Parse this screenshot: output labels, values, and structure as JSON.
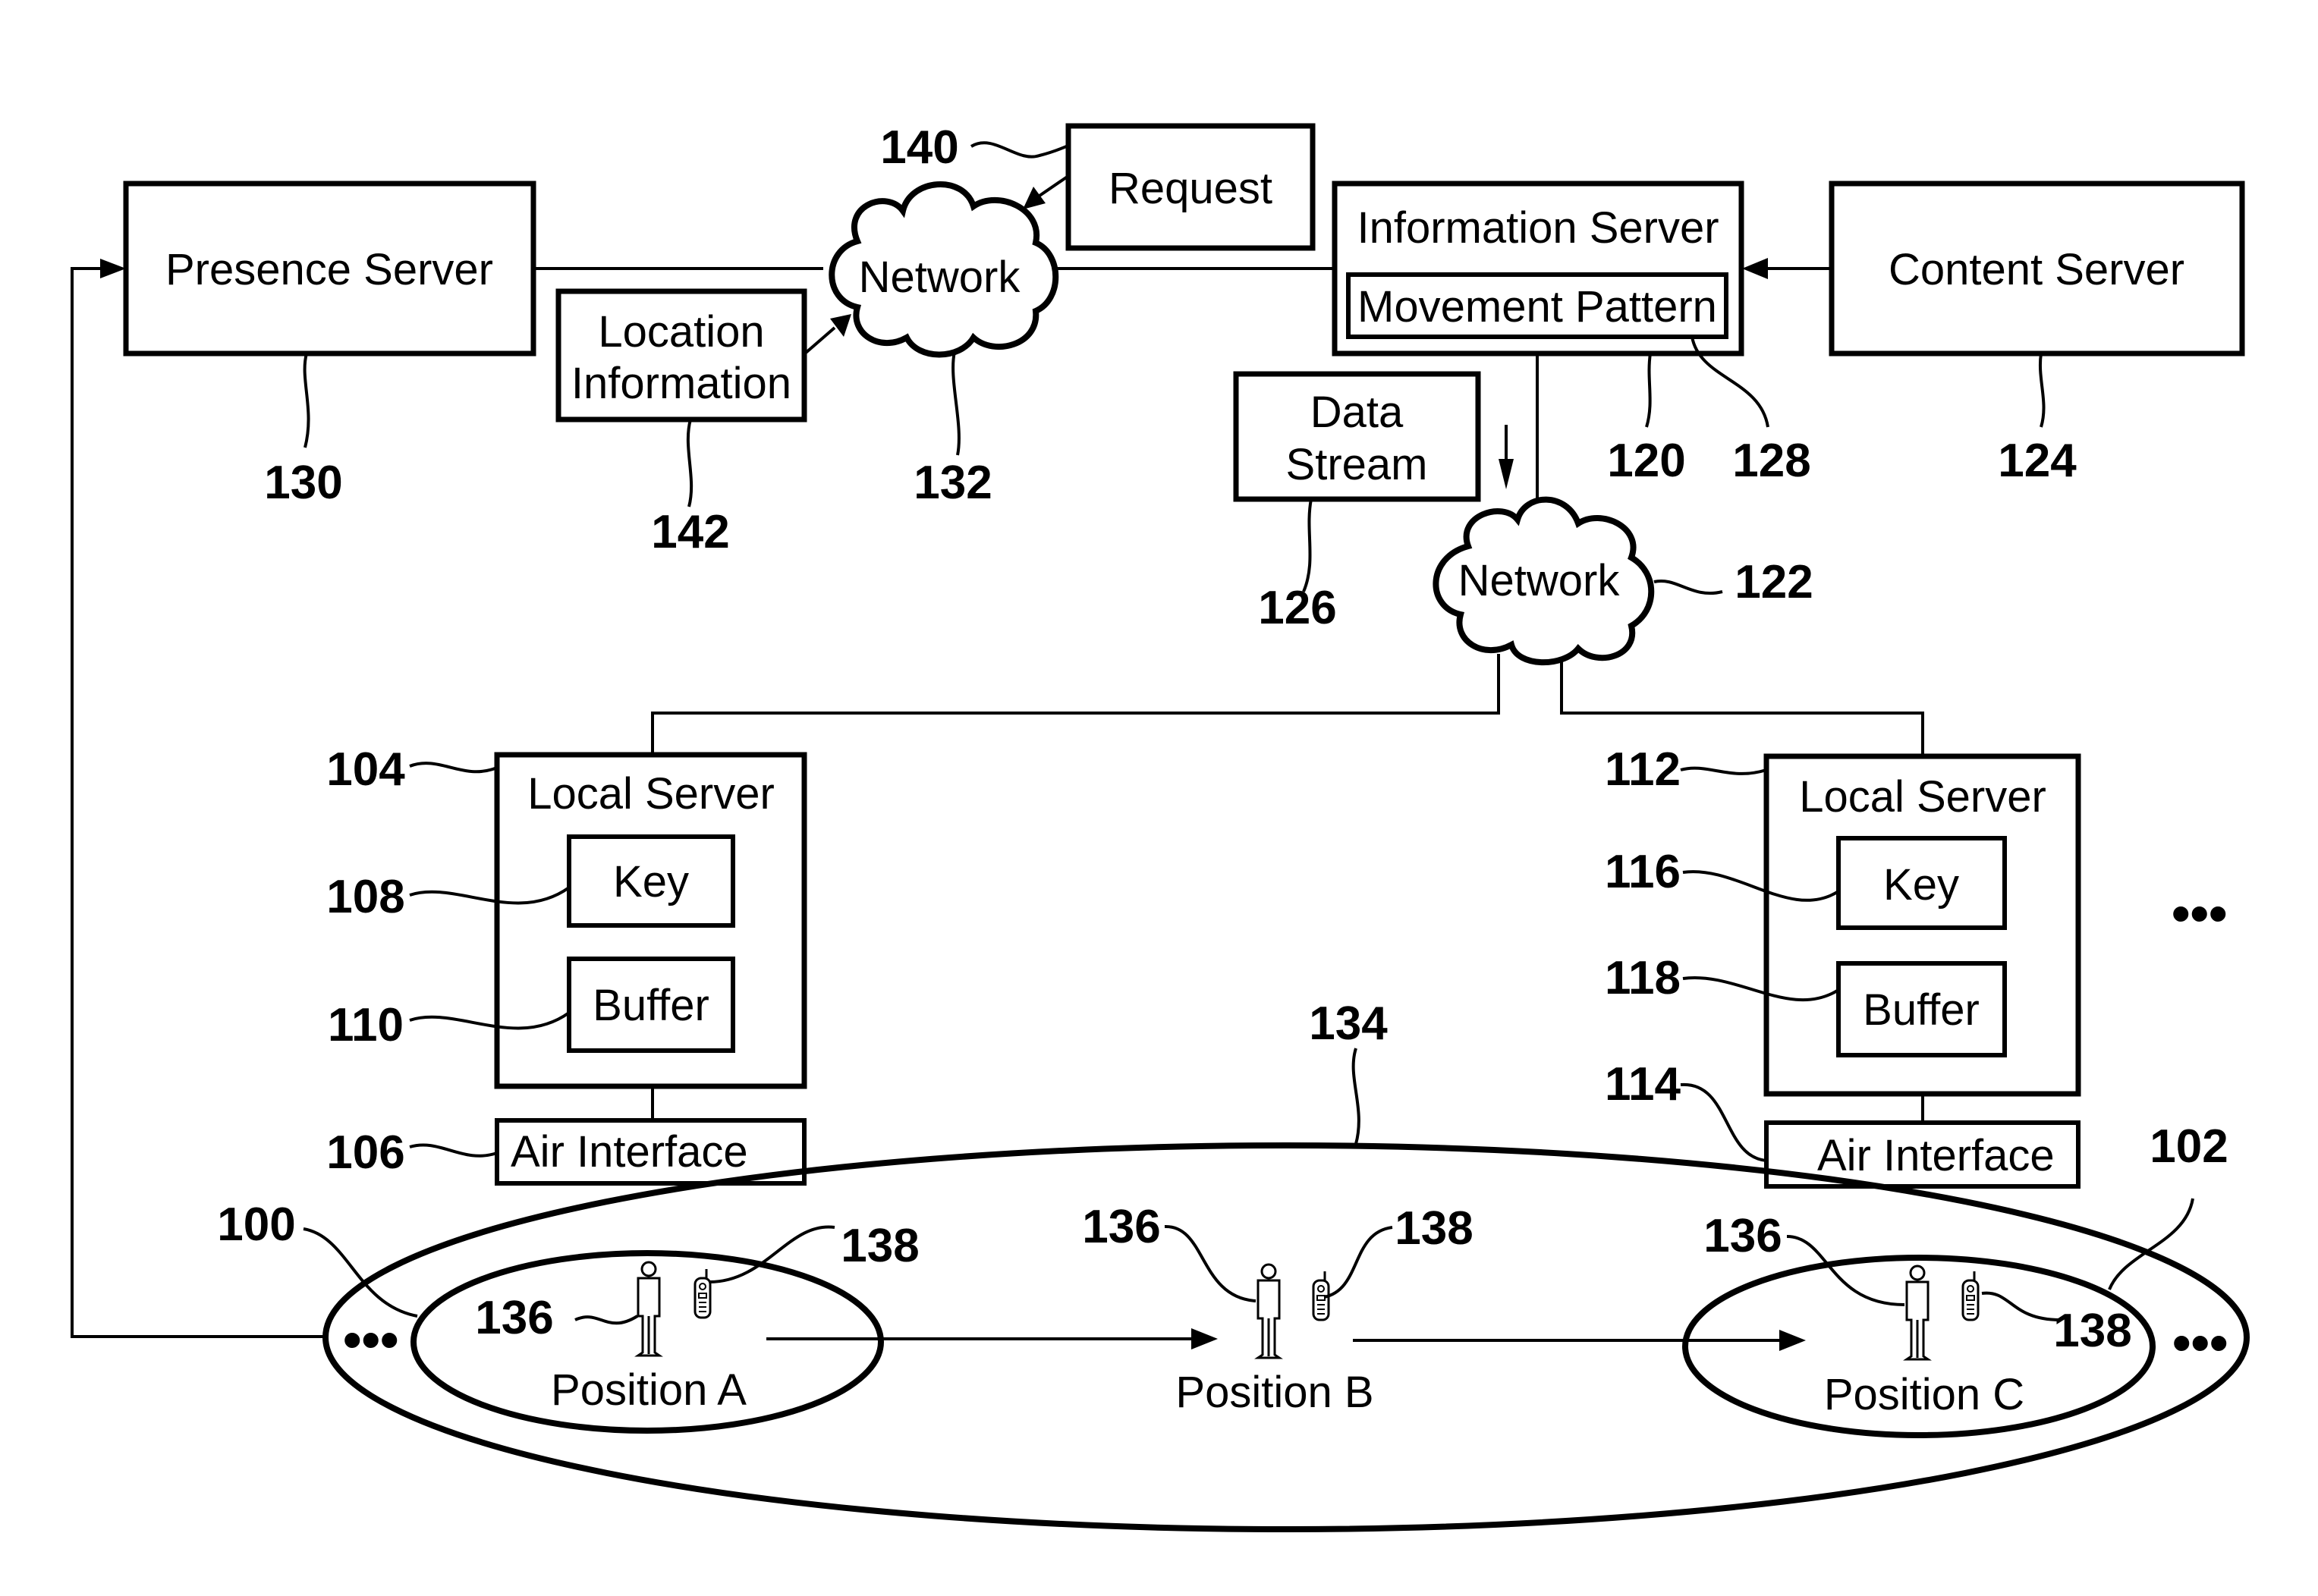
{
  "figure": {
    "type": "patent-system-diagram",
    "colors": {
      "ink": "#000000",
      "paper": "#ffffff"
    }
  },
  "nodes": {
    "presence_server": {
      "label": "Presence Server",
      "ref": "130"
    },
    "network_upper": {
      "label": "Network",
      "ref": "132"
    },
    "request": {
      "label": "Request",
      "ref": "140"
    },
    "location_information": {
      "label_line1": "Location",
      "label_line2": "Information",
      "ref": "142"
    },
    "information_server": {
      "label": "Information Server",
      "ref": "120"
    },
    "movement_pattern": {
      "label": "Movement Pattern",
      "ref": "128"
    },
    "content_server": {
      "label": "Content Server",
      "ref": "124"
    },
    "data_stream": {
      "label_line1": "Data",
      "label_line2": "Stream",
      "ref": "126"
    },
    "network_lower": {
      "label": "Network",
      "ref": "122"
    },
    "local_server_left": {
      "label": "Local Server",
      "ref": "104"
    },
    "key_left": {
      "label": "Key",
      "ref": "108"
    },
    "buffer_left": {
      "label": "Buffer",
      "ref": "110"
    },
    "air_interface_left": {
      "label": "Air Interface",
      "ref": "106"
    },
    "local_server_right": {
      "label": "Local Server",
      "ref": "112"
    },
    "key_right": {
      "label": "Key",
      "ref": "116"
    },
    "buffer_right": {
      "label": "Buffer",
      "ref": "118"
    },
    "air_interface_right": {
      "label": "Air Interface",
      "ref": "114"
    },
    "coverage_area": {
      "ref": "134"
    },
    "cell_left": {
      "ref": "100"
    },
    "cell_right": {
      "ref": "102"
    }
  },
  "positions": [
    {
      "label": "Position A",
      "user_ref": "136",
      "device_ref": "138"
    },
    {
      "label": "Position B",
      "user_ref": "136",
      "device_ref": "138"
    },
    {
      "label": "Position C",
      "user_ref": "136",
      "device_ref": "138"
    }
  ],
  "ellipsis": "•••",
  "icons": {
    "user": "person-icon",
    "device": "mobile-phone-icon"
  }
}
